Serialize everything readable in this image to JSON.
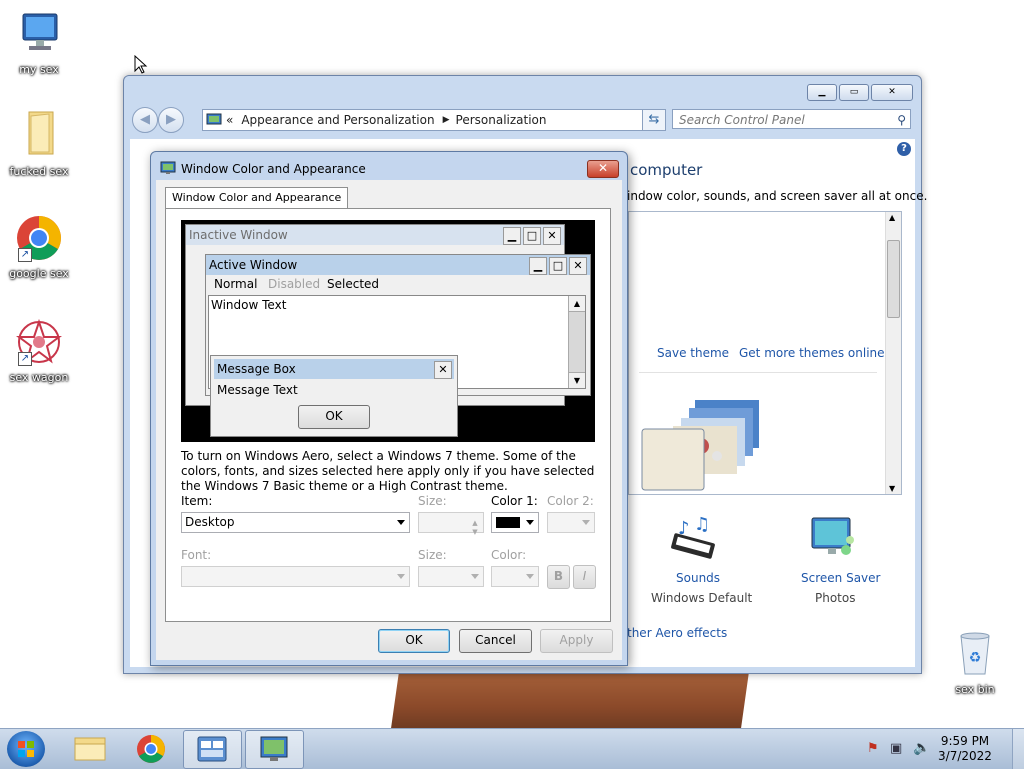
{
  "desktop": {
    "icons": [
      {
        "label": "my sex"
      },
      {
        "label": "fucked sex"
      },
      {
        "label": "google sex"
      },
      {
        "label": "sex wagon"
      },
      {
        "label": "sex bin"
      }
    ]
  },
  "control_panel": {
    "address_prefix": "«",
    "breadcrumb": [
      "Appearance and Personalization",
      "Personalization"
    ],
    "search_placeholder": "Search Control Panel",
    "heading_partial": "computer",
    "subtitle_partial": "indow color, sounds, and screen saver all at once.",
    "save_theme": "Save theme",
    "more_themes": "Get more themes online",
    "sounds_label": "Sounds",
    "sounds_value": "Windows Default",
    "screensaver_label": "Screen Saver",
    "screensaver_value": "Photos",
    "aero_link": "ther Aero effects"
  },
  "dialog": {
    "title": "Window Color and Appearance",
    "tab": "Window Color and Appearance",
    "preview": {
      "inactive_title": "Inactive Window",
      "active_title": "Active Window",
      "menu_normal": "Normal",
      "menu_disabled": "Disabled",
      "menu_selected": "Selected",
      "window_text": "Window Text",
      "msgbox_title": "Message Box",
      "msgbox_text": "Message Text",
      "msgbox_ok": "OK"
    },
    "info_text": "To turn on Windows Aero, select a Windows 7 theme.  Some of the colors, fonts, and sizes selected here apply only if you have selected the Windows 7 Basic theme or a High Contrast theme.",
    "item_label": "Item:",
    "item_value": "Desktop",
    "size_label": "Size:",
    "color1_label": "Color 1:",
    "color1_value": "#000000",
    "color2_label": "Color 2:",
    "font_label": "Font:",
    "font_size_label": "Size:",
    "font_color_label": "Color:",
    "bold": "B",
    "italic": "I",
    "ok": "OK",
    "cancel": "Cancel",
    "apply": "Apply"
  },
  "taskbar": {
    "time": "9:59 PM",
    "date": "3/7/2022"
  },
  "colors": {
    "link": "#1f56a8",
    "active_title": "#b9d1ea",
    "inactive_title": "#d7e2ef",
    "message_box_title": "#b9d1ea"
  }
}
